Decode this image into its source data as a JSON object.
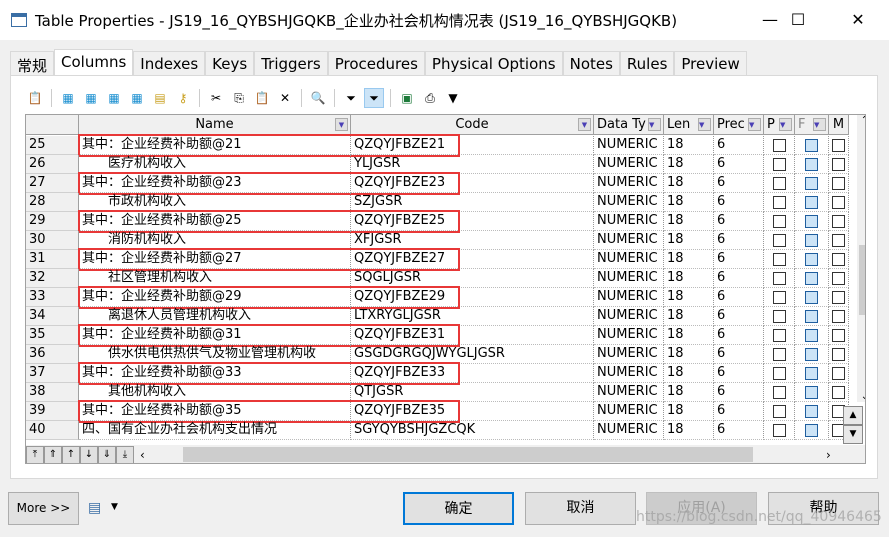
{
  "window": {
    "title": "Table Properties - JS19_16_QYBSHJGQKB_企业办社会机构情况表 (JS19_16_QYBSHJGQKB)",
    "minimize": "—",
    "maximize": "☐",
    "close": "✕"
  },
  "tabs": [
    "常规",
    "Columns",
    "Indexes",
    "Keys",
    "Triggers",
    "Procedures",
    "Physical Options",
    "Notes",
    "Rules",
    "Preview"
  ],
  "active_tab": "Columns",
  "columns": [
    {
      "label": "Name"
    },
    {
      "label": "Code"
    },
    {
      "label": "Data Ty"
    },
    {
      "label": "Len"
    },
    {
      "label": "Prec"
    },
    {
      "label": "P"
    },
    {
      "label": "F"
    },
    {
      "label": "M"
    }
  ],
  "rows": [
    {
      "n": "25",
      "name": "其中：企业经费补助额@21",
      "code": "QZQYJFBZE21",
      "type": "NUMERIC",
      "len": "18",
      "prec": "6",
      "hl": true
    },
    {
      "n": "26",
      "name": "　　医疗机构收入",
      "code": "YLJGSR",
      "type": "NUMERIC",
      "len": "18",
      "prec": "6"
    },
    {
      "n": "27",
      "name": "其中：企业经费补助额@23",
      "code": "QZQYJFBZE23",
      "type": "NUMERIC",
      "len": "18",
      "prec": "6",
      "hl": true
    },
    {
      "n": "28",
      "name": "　　市政机构收入",
      "code": "SZJGSR",
      "type": "NUMERIC",
      "len": "18",
      "prec": "6"
    },
    {
      "n": "29",
      "name": "其中：企业经费补助额@25",
      "code": "QZQYJFBZE25",
      "type": "NUMERIC",
      "len": "18",
      "prec": "6",
      "hl": true
    },
    {
      "n": "30",
      "name": "　　消防机构收入",
      "code": "XFJGSR",
      "type": "NUMERIC",
      "len": "18",
      "prec": "6"
    },
    {
      "n": "31",
      "name": "其中：企业经费补助额@27",
      "code": "QZQYJFBZE27",
      "type": "NUMERIC",
      "len": "18",
      "prec": "6",
      "hl": true
    },
    {
      "n": "32",
      "name": "　　社区管理机构收入",
      "code": "SQGLJGSR",
      "type": "NUMERIC",
      "len": "18",
      "prec": "6"
    },
    {
      "n": "33",
      "name": "其中：企业经费补助额@29",
      "code": "QZQYJFBZE29",
      "type": "NUMERIC",
      "len": "18",
      "prec": "6",
      "hl": true
    },
    {
      "n": "34",
      "name": "　　离退休人员管理机构收入",
      "code": "LTXRYGLJGSR",
      "type": "NUMERIC",
      "len": "18",
      "prec": "6"
    },
    {
      "n": "35",
      "name": "其中：企业经费补助额@31",
      "code": "QZQYJFBZE31",
      "type": "NUMERIC",
      "len": "18",
      "prec": "6",
      "hl": true
    },
    {
      "n": "36",
      "name": "　　供水供电供热供气及物业管理机构收",
      "code": "GSGDGRGQJWYGLJGSR",
      "type": "NUMERIC",
      "len": "18",
      "prec": "6"
    },
    {
      "n": "37",
      "name": "其中：企业经费补助额@33",
      "code": "QZQYJFBZE33",
      "type": "NUMERIC",
      "len": "18",
      "prec": "6",
      "hl": true
    },
    {
      "n": "38",
      "name": "　　其他机构收入",
      "code": "QTJGSR",
      "type": "NUMERIC",
      "len": "18",
      "prec": "6"
    },
    {
      "n": "39",
      "name": "其中：企业经费补助额@35",
      "code": "QZQYJFBZE35",
      "type": "NUMERIC",
      "len": "18",
      "prec": "6",
      "hl": true
    },
    {
      "n": "40",
      "name": "四、国有企业办社会机构支出情况",
      "code": "SGYQYBSHJGZCQK",
      "type": "NUMERIC",
      "len": "18",
      "prec": "6"
    }
  ],
  "highlight_color": "#e83737",
  "buttons": {
    "more": "More >>",
    "ok": "确定",
    "cancel": "取消",
    "apply": "应用(A)",
    "help": "帮助"
  },
  "watermark": "https://blog.csdn.net/qq_40946465"
}
